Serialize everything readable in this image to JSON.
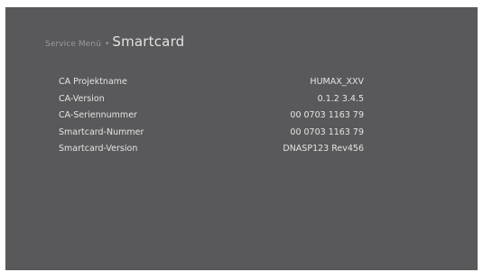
{
  "header": {
    "breadcrumb_parent": "Service Menü",
    "breadcrumb_separator": "•",
    "breadcrumb_current": "Smartcard"
  },
  "rows": [
    {
      "label": "CA Projektname",
      "value": "HUMAX_XXV"
    },
    {
      "label": "CA-Version",
      "value": "0.1.2 3.4.5"
    },
    {
      "label": "CA-Seriennummer",
      "value": "00 0703 1163 79"
    },
    {
      "label": "Smartcard-Nummer",
      "value": "00 0703 1163 79"
    },
    {
      "label": "Smartcard-Version",
      "value": "DNASP123 Rev456"
    }
  ],
  "colors": {
    "background": "#59595b",
    "text_primary": "#e4e4e4",
    "text_muted": "#9a9a9c"
  }
}
